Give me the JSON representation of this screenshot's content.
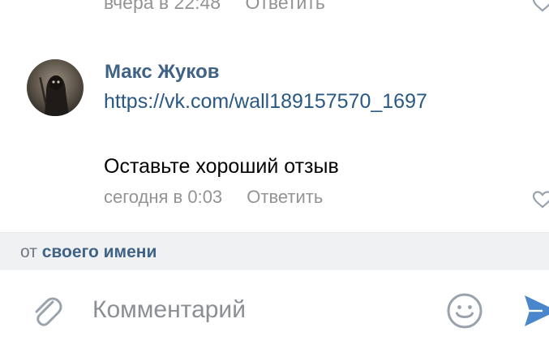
{
  "previous_comment": {
    "time": "вчера в 22:48",
    "reply_label": "Ответить"
  },
  "comment": {
    "author": "Макс Жуков",
    "link": "https://vk.com/wall189157570_1697",
    "text": "Оставьте хороший отзыв",
    "time": "сегодня в 0:03",
    "reply_label": "Ответить"
  },
  "from_bar": {
    "prefix": "от",
    "name": "своего имени"
  },
  "composer": {
    "placeholder": "Комментарий"
  },
  "icons": {
    "attach": "paperclip-icon",
    "emoji": "smiley-icon",
    "send": "send-icon",
    "like": "heart-icon"
  },
  "colors": {
    "author": "#3f6286",
    "link": "#2a5885",
    "meta": "#939393",
    "send": "#4986cc",
    "bar_bg": "#f0f1f3"
  }
}
